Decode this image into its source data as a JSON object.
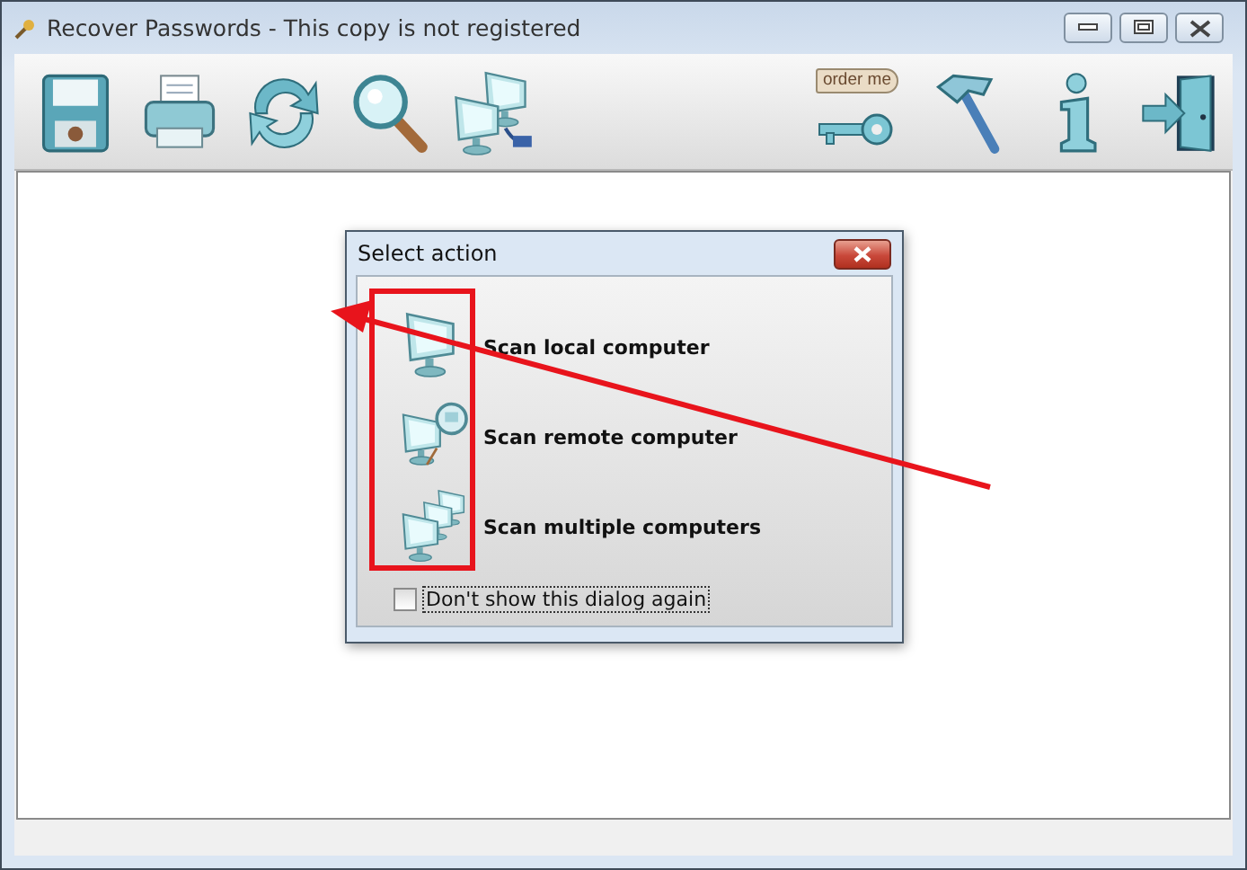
{
  "window": {
    "title": "Recover Passwords - This copy is not registered"
  },
  "toolbar": {
    "left": [
      {
        "kind": "disk"
      },
      {
        "kind": "printer"
      },
      {
        "kind": "refresh"
      },
      {
        "kind": "search"
      },
      {
        "kind": "network"
      }
    ],
    "right": [
      {
        "kind": "order",
        "label": "order me"
      },
      {
        "kind": "hammer"
      },
      {
        "kind": "info"
      },
      {
        "kind": "exit"
      }
    ]
  },
  "dialog": {
    "title": "Select action",
    "actions": [
      {
        "kind": "local",
        "label": "Scan local computer"
      },
      {
        "kind": "remote",
        "label": "Scan remote computer"
      },
      {
        "kind": "multiple",
        "label": "Scan multiple computers"
      }
    ],
    "checkbox": {
      "label": "Don't show this dialog again",
      "checked": false
    }
  },
  "annotations": {
    "highlight_box": true,
    "arrow": true
  }
}
